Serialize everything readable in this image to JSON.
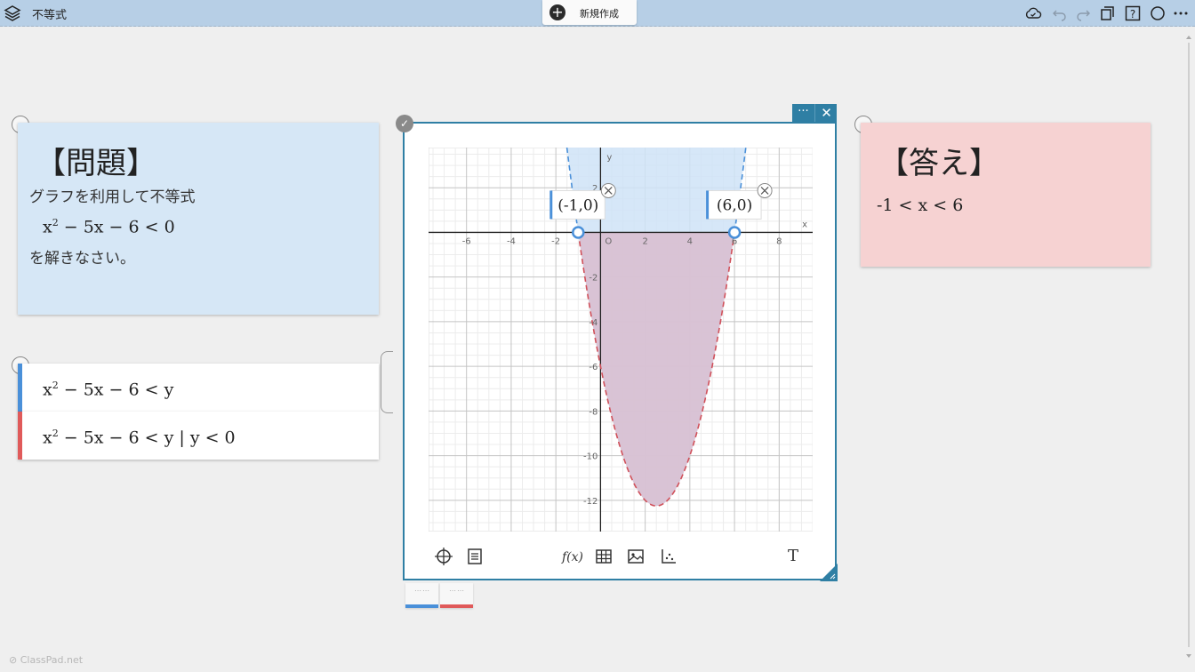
{
  "app": {
    "document_title": "不等式",
    "new_button_label": "新規作成",
    "footer": "ClassPad.net"
  },
  "colors": {
    "topbar": "#b7cfe6",
    "accent": "#2f7fa4",
    "blue_series": "#4a90d9",
    "red_series": "#e05a5a",
    "note_blue": "#d6e7f6",
    "note_red": "#f6d2d2"
  },
  "toolbar_icons": [
    "cloud-icon",
    "undo-icon",
    "redo-icon",
    "copy-icon",
    "help-icon",
    "circle-icon",
    "more-icon"
  ],
  "problem_note": {
    "heading": "【問題】",
    "line1": "グラフを利用して不等式",
    "math_main": "x",
    "math_exp": "2",
    "math_rest": " − 5x − 6 < 0",
    "line2": "を解きなさい。"
  },
  "answer_note": {
    "heading": "【答え】",
    "answer": "-1 < x < 6"
  },
  "expressions": [
    {
      "base": "x",
      "exp": "2",
      "rest": " − 5x − 6 < y",
      "color": "#4a90d9"
    },
    {
      "base": "x",
      "exp": "2",
      "rest": " − 5x − 6 < y | y < 0",
      "color": "#e05a5a"
    }
  ],
  "chart_data": {
    "type": "line",
    "axes": {
      "xlabel": "x",
      "ylabel": "y",
      "origin_label": "O",
      "xlim": [
        -7.7,
        9.5
      ],
      "ylim": [
        -13.4,
        3.8
      ]
    },
    "x_ticks": [
      -6,
      -4,
      -2,
      2,
      4,
      6,
      8
    ],
    "y_ticks": [
      2,
      -2,
      -4,
      -6,
      -8,
      -10,
      -12
    ],
    "grid": true,
    "series": [
      {
        "expression": "y = x^2 - 5x - 6",
        "style": "dashed",
        "color_blue": "#4a90d9",
        "color_red": "#d0505a"
      }
    ],
    "shaded_regions": [
      {
        "condition": "y > x^2 - 5x - 6",
        "color": "#cfe3f7"
      },
      {
        "condition": "y > x^2 - 5x - 6 and y < 0",
        "color": "#d9bfd0"
      }
    ],
    "points": [
      {
        "x": -1,
        "y": 0,
        "label": "(-1,0)"
      },
      {
        "x": 6,
        "y": 0,
        "label": "(6,0)"
      }
    ]
  },
  "graph_tools": [
    "trace-icon",
    "list-icon",
    "function-icon",
    "table-icon",
    "image-icon",
    "scatter-icon",
    "text-icon"
  ],
  "graph_tool_labels": {
    "function": "f(x)",
    "text": "T"
  }
}
